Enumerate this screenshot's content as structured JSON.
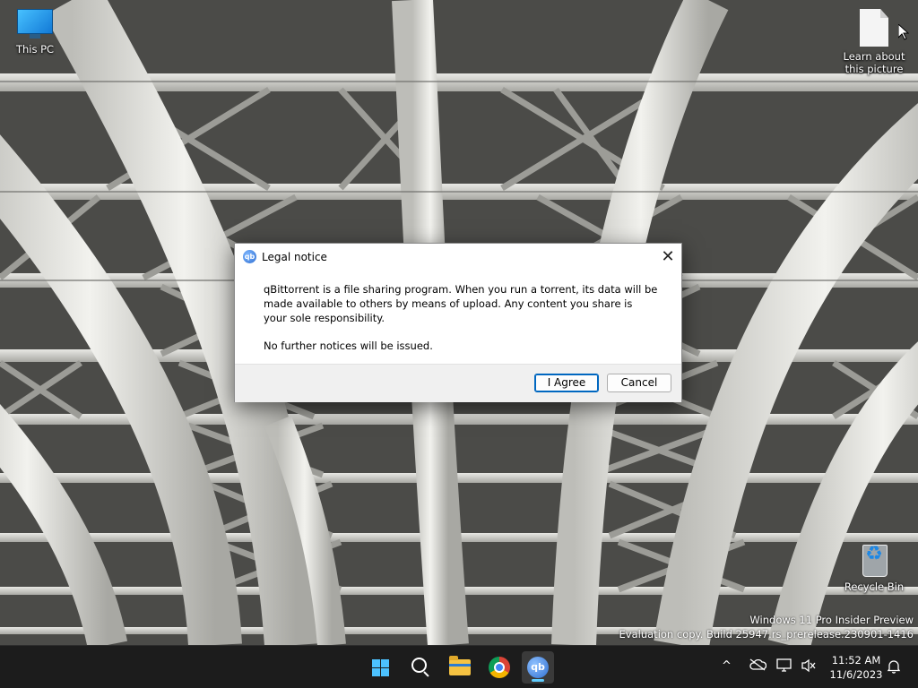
{
  "desktop": {
    "icons": [
      {
        "label": "This PC",
        "icon": "this-pc-icon"
      },
      {
        "label": "Learn about\nthis picture",
        "line1": "Learn about",
        "line2": "this picture",
        "icon": "document-icon"
      },
      {
        "label": "Recycle Bin",
        "icon": "recycle-bin-icon"
      }
    ],
    "watermark": {
      "line1": "Windows 11 Pro Insider Preview",
      "line2": "Evaluation copy. Build 25947.rs_prerelease.230901-1416"
    }
  },
  "dialog": {
    "title": "Legal notice",
    "message": "qBittorrent is a file sharing program. When you run a torrent, its data will be made available to others by means of upload. Any content you share is your sole responsibility.",
    "message2": "No further notices will be issued.",
    "buttons": {
      "agree": "I Agree",
      "cancel": "Cancel"
    },
    "close_glyph": "✕",
    "app_icon_text": "qb"
  },
  "taskbar": {
    "apps": [
      "windows-start",
      "search",
      "file-explorer",
      "chrome",
      "qbittorrent"
    ],
    "qb_label": "qb",
    "tray": {
      "chevron": "^",
      "time": "11:52 AM",
      "date": "11/6/2023"
    }
  },
  "colors": {
    "accent": "#0067c0",
    "taskbar_bg": "#1c1c1c",
    "windows_blue": "#4cc2ff"
  }
}
